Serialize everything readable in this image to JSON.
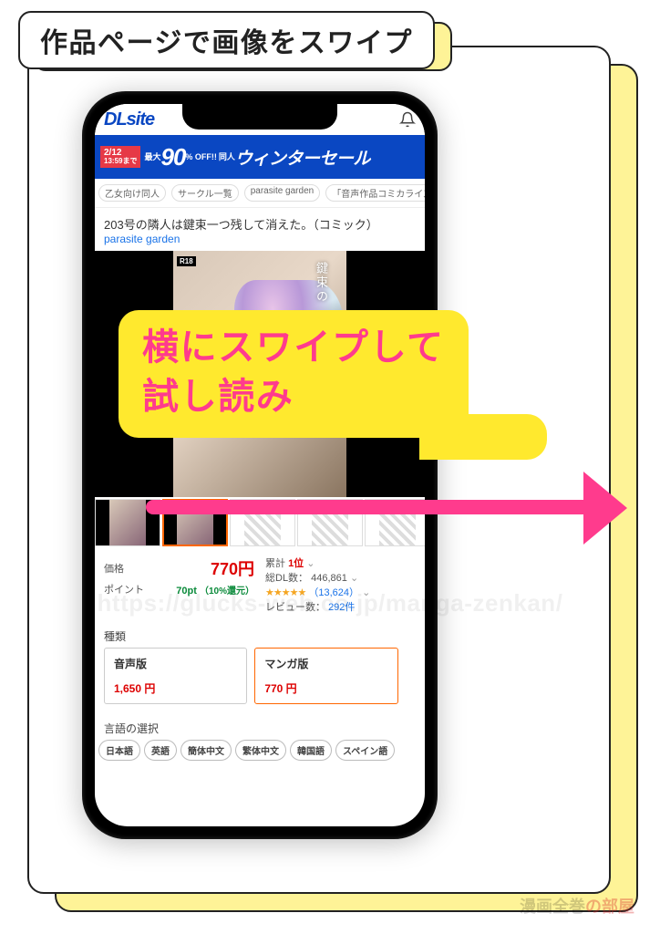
{
  "frame_title": "作品ページで画像をスワイプ",
  "callout": {
    "line1": "横にスワイプして",
    "line2": "試し読み"
  },
  "watermark": "https://glucks-web.co.jp/manga-zenkan/",
  "brand": {
    "a": "漫画全巻",
    "b": "の部屋"
  },
  "header": {
    "logo": "DLsite",
    "bell_icon": "bell-icon"
  },
  "promo": {
    "date": "2/12",
    "time_until": "13:59まで",
    "prefix": "最大",
    "percent": "90",
    "off": "% OFF!!",
    "line_small": "同人",
    "sale_text": "ウィンターセール"
  },
  "breadcrumbs": [
    "乙女向け同人",
    "サークル一覧",
    "parasite garden",
    "「音声作品コミカライズ」シリーズ"
  ],
  "product": {
    "title": "203号の隣人は鍵束一つ残して消えた。（コミック）",
    "circle": "parasite garden",
    "cover_text": "鍵束の",
    "r18": "R18"
  },
  "stats": {
    "price_label": "価格",
    "price": "770円",
    "point_label": "ポイント",
    "point": "70pt",
    "point_note": "（10%還元）",
    "rank_label": "累計",
    "rank_value": "1位",
    "dl_label": "総DL数：",
    "dl_value": "446,861",
    "rating_count": "（13,624）",
    "review_label": "レビュー数：",
    "review_value": "292件"
  },
  "variants_heading": "種類",
  "variants": [
    {
      "name": "音声版",
      "price": "1,650 円"
    },
    {
      "name": "マンガ版",
      "price": "770 円"
    }
  ],
  "lang_heading": "言語の選択",
  "languages": [
    "日本語",
    "英語",
    "簡体中文",
    "繁体中文",
    "韓国語",
    "スペイン語"
  ]
}
